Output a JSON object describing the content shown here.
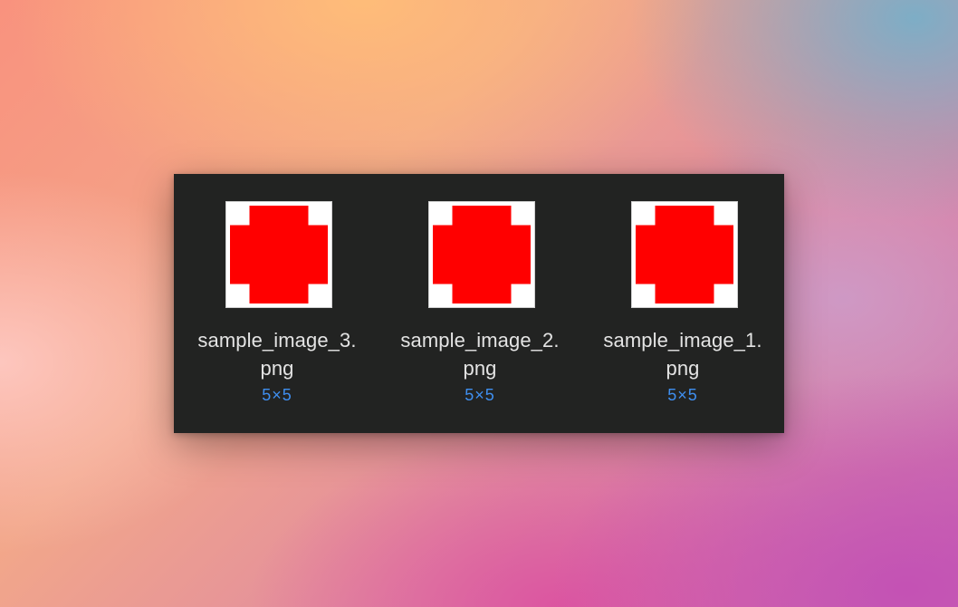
{
  "files": [
    {
      "name_line1": "sample_image_3.",
      "name_line2": "png",
      "dimensions": "5×5",
      "icon": "image-thumbnail-icon"
    },
    {
      "name_line1": "sample_image_2.",
      "name_line2": "png",
      "dimensions": "5×5",
      "icon": "image-thumbnail-icon"
    },
    {
      "name_line1": "sample_image_1.",
      "name_line2": "png",
      "dimensions": "5×5",
      "icon": "image-thumbnail-icon"
    }
  ],
  "colors": {
    "panel_background": "#222322",
    "filename_text": "#e4e4e4",
    "dimensions_text": "#3f8ff0",
    "thumbnail_fill": "#ff0000",
    "thumbnail_background": "#ffffff"
  }
}
